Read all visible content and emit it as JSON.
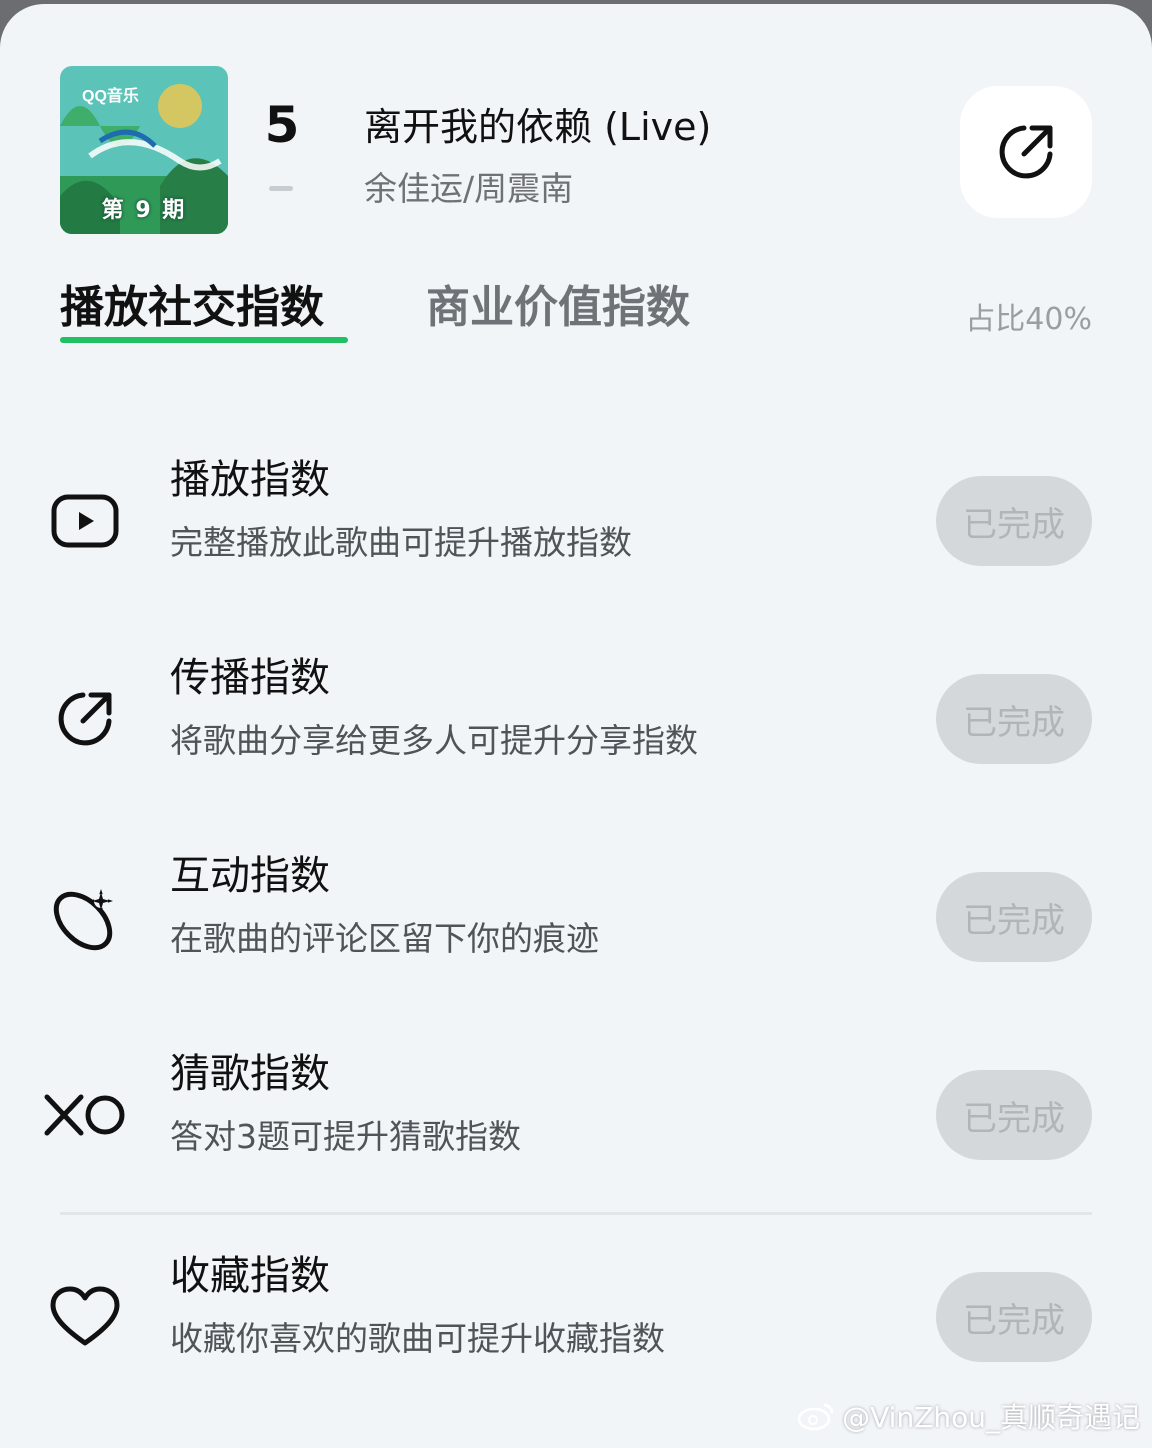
{
  "album": {
    "brand": "QQ音乐",
    "issue": "第 9 期",
    "cover_colors": {
      "sky": "#5bc3b8",
      "leaves": "#2f9a58",
      "accent": "#f2c84b"
    }
  },
  "song": {
    "rank": "5",
    "title": "离开我的依赖 (Live)",
    "artist": "余佳运/周震南"
  },
  "tabs": [
    {
      "label": "播放社交指数",
      "active": true
    },
    {
      "label": "商业价值指数",
      "active": false
    }
  ],
  "ratio_label": "占比40%",
  "tasks": [
    {
      "icon": "play-icon",
      "name": "播放指数",
      "desc": "完整播放此歌曲可提升播放指数",
      "status": "已完成"
    },
    {
      "icon": "share-icon",
      "name": "传播指数",
      "desc": "将歌曲分享给更多人可提升分享指数",
      "status": "已完成"
    },
    {
      "icon": "comment-sparkle-icon",
      "name": "互动指数",
      "desc": "在歌曲的评论区留下你的痕迹",
      "status": "已完成"
    },
    {
      "icon": "xo-icon",
      "name": "猜歌指数",
      "desc": "答对3题可提升猜歌指数",
      "status": "已完成"
    },
    {
      "icon": "heart-icon",
      "name": "收藏指数",
      "desc": "收藏你喜欢的歌曲可提升收藏指数",
      "status": "已完成"
    }
  ],
  "watermark": "@VinZhou_真顺奇遇记",
  "colors": {
    "accent": "#20c064",
    "sheet_bg": "#f2f5f8",
    "done_bg": "#d5d8db",
    "done_text": "#b2b5b8"
  }
}
